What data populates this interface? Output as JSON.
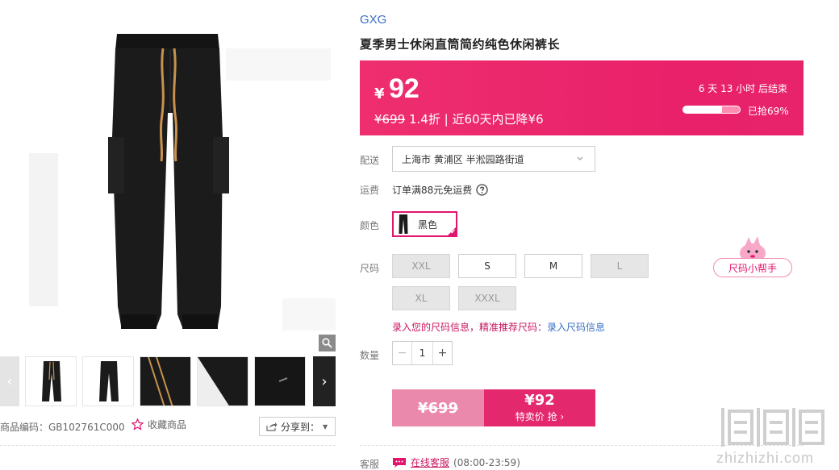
{
  "gallery": {
    "sku_code": "商品编码：GB102761C000",
    "favorite_label": "收藏商品",
    "share_label": "分享到："
  },
  "product": {
    "brand": "GXG",
    "title": "夏季男士休闲直筒简约纯色休闲裤长"
  },
  "price_banner": {
    "currency": "¥",
    "price": "92",
    "original_price": "¥699",
    "discount": "1.4折",
    "sub_note": "近60天内已降¥6",
    "countdown": "6 天 13 小时 后结束",
    "sold_label": "已抢69%",
    "sold_fraction": 0.69
  },
  "delivery": {
    "label": "配送",
    "address": "上海市 黄浦区 半淞园路街道"
  },
  "shipping": {
    "label": "运费",
    "text": "订单满88元免运费"
  },
  "color": {
    "label": "颜色",
    "selected": "黑色"
  },
  "size": {
    "label": "尺码",
    "options": [
      {
        "label": "XXL",
        "available": false
      },
      {
        "label": "S",
        "available": true
      },
      {
        "label": "M",
        "available": true
      },
      {
        "label": "L",
        "available": false
      },
      {
        "label": "XL",
        "available": false
      },
      {
        "label": "XXXL",
        "available": false
      }
    ],
    "helper_label": "尺码小帮手",
    "tip": "录入您的尺码信息，精准推荐尺码：",
    "tip_link": "录入尺码信息"
  },
  "quantity": {
    "label": "数量",
    "value": "1"
  },
  "buy": {
    "original_price": "¥699",
    "price": "¥92",
    "action_label": "特卖价 抢"
  },
  "service": {
    "label": "客服",
    "link": "在线客服",
    "hours": "(08:00-23:59)"
  },
  "watermark": {
    "domain": "zhizhizhi.com"
  },
  "colors": {
    "accent": "#e4286d",
    "brand_link": "#3a6fc4"
  }
}
